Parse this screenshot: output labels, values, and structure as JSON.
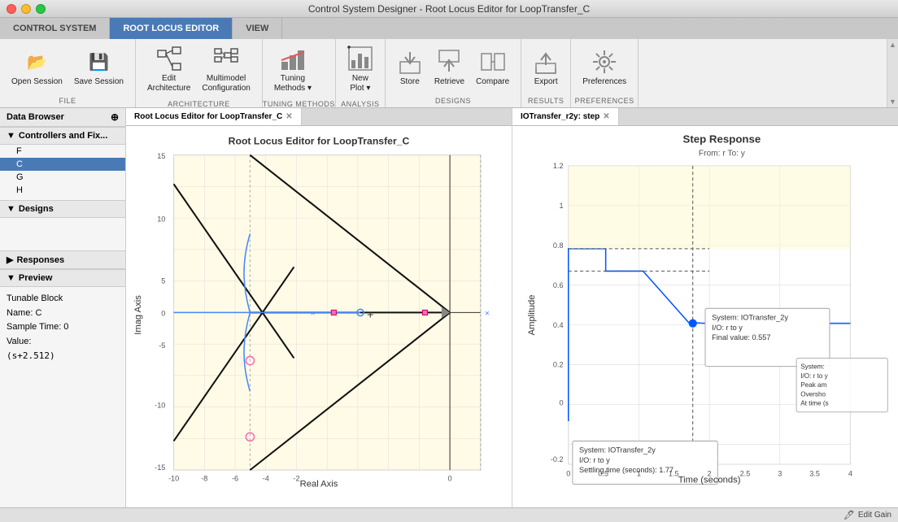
{
  "window": {
    "title": "Control System Designer - Root Locus Editor for LoopTransfer_C"
  },
  "tabs": [
    {
      "id": "control-system",
      "label": "CONTROL SYSTEM",
      "active": false
    },
    {
      "id": "root-locus-editor",
      "label": "ROOT LOCUS EDITOR",
      "active": true
    },
    {
      "id": "view",
      "label": "VIEW",
      "active": false
    }
  ],
  "toolbar": {
    "file": {
      "label": "FILE",
      "buttons": [
        {
          "id": "open-session",
          "label": "Open\nSession",
          "icon": "📂"
        },
        {
          "id": "save-session",
          "label": "Save\nSession",
          "icon": "💾"
        }
      ]
    },
    "architecture": {
      "label": "ARCHITECTURE",
      "buttons": [
        {
          "id": "edit-architecture",
          "label": "Edit\nArchitecture",
          "icon": "🏗"
        },
        {
          "id": "multimodel-config",
          "label": "Multimodel\nConfiguration",
          "icon": "⚙"
        }
      ]
    },
    "tuning_methods": {
      "label": "TUNING METHODS",
      "buttons": [
        {
          "id": "tuning-methods",
          "label": "Tuning\nMethods ▾",
          "icon": "📐"
        }
      ]
    },
    "analysis": {
      "label": "ANALYSIS",
      "buttons": [
        {
          "id": "new-plot",
          "label": "New\nPlot ▾",
          "icon": "📊"
        }
      ]
    },
    "designs": {
      "label": "DESIGNS",
      "buttons": [
        {
          "id": "store",
          "label": "Store",
          "icon": "📥"
        },
        {
          "id": "retrieve",
          "label": "Retrieve",
          "icon": "📤"
        },
        {
          "id": "compare",
          "label": "Compare",
          "icon": "⚖"
        }
      ]
    },
    "results": {
      "label": "RESULTS",
      "buttons": [
        {
          "id": "export",
          "label": "Export",
          "icon": "📨"
        }
      ]
    },
    "preferences": {
      "label": "PREFERENCES",
      "buttons": [
        {
          "id": "preferences",
          "label": "Preferences",
          "icon": "⚙"
        }
      ]
    }
  },
  "sidebar": {
    "header": "Data Browser",
    "tree": {
      "label": "Controllers and Fix...",
      "items": [
        {
          "id": "F",
          "label": "F",
          "selected": false
        },
        {
          "id": "C",
          "label": "C",
          "selected": true
        },
        {
          "id": "G",
          "label": "G",
          "selected": false
        },
        {
          "id": "H",
          "label": "H",
          "selected": false
        }
      ]
    },
    "designs": {
      "label": "Designs",
      "items": []
    },
    "responses": {
      "label": "Responses"
    },
    "preview": {
      "label": "Preview",
      "fields": [
        {
          "key": "type",
          "value": "Tunable Block"
        },
        {
          "key": "name_label",
          "value": "Name: C"
        },
        {
          "key": "sample_time",
          "value": "Sample Time: 0"
        },
        {
          "key": "value_label",
          "value": "Value:"
        },
        {
          "key": "value_expr",
          "value": "  (s+2.512)"
        }
      ]
    }
  },
  "plots": {
    "left": {
      "tab_label": "Root Locus Editor for LoopTransfer_C",
      "title": "Root Locus Editor for LoopTransfer_C",
      "x_label": "Real Axis",
      "y_label": "Imag Axis",
      "x_range": [
        -12,
        2
      ],
      "y_range": [
        -16,
        17
      ]
    },
    "right": {
      "tab_label": "IOTransfer_r2y: step",
      "title": "Step Response",
      "subtitle": "From: r  To: y",
      "x_label": "Time (seconds)",
      "y_label": "Amplitude",
      "tooltip1": {
        "system": "IOTransfer_2y",
        "io": "I/O: r to y",
        "settling_time": "Settling time (seconds): 1.77"
      },
      "tooltip2": {
        "system": "IOTransfer_2y",
        "io": "I/O: r to y",
        "peak_am": "Peak am",
        "overshoo": "Oversho",
        "final_value": "Final value: 0.557",
        "at_time": "At time (s"
      }
    }
  },
  "status_bar": {
    "edit_gain": "Edit Gain"
  }
}
